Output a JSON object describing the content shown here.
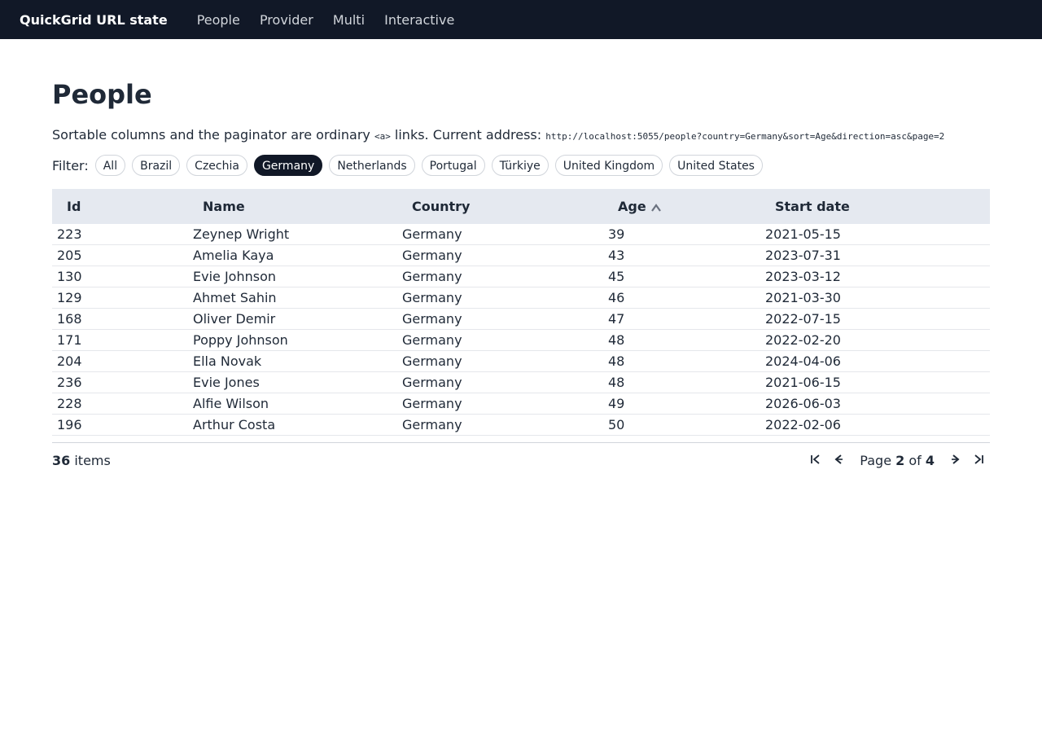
{
  "topbar": {
    "brand": "QuickGrid URL state",
    "nav": [
      "People",
      "Provider",
      "Multi",
      "Interactive"
    ]
  },
  "page": {
    "title": "People",
    "intro_before": "Sortable columns and the paginator are ordinary ",
    "intro_code": "<a>",
    "intro_after": " links. Current address: ",
    "current_address": "http://localhost:5055/people?country=Germany&sort=Age&direction=asc&page=2"
  },
  "filter": {
    "label": "Filter:",
    "options": [
      "All",
      "Brazil",
      "Czechia",
      "Germany",
      "Netherlands",
      "Portugal",
      "Türkiye",
      "United Kingdom",
      "United States"
    ],
    "selected": "Germany"
  },
  "table": {
    "columns": [
      "Id",
      "Name",
      "Country",
      "Age",
      "Start date"
    ],
    "sorted_column": "Age",
    "sort_direction": "asc",
    "rows": [
      [
        "223",
        "Zeynep Wright",
        "Germany",
        "39",
        "2021-05-15"
      ],
      [
        "205",
        "Amelia Kaya",
        "Germany",
        "43",
        "2023-07-31"
      ],
      [
        "130",
        "Evie Johnson",
        "Germany",
        "45",
        "2023-03-12"
      ],
      [
        "129",
        "Ahmet Sahin",
        "Germany",
        "46",
        "2021-03-30"
      ],
      [
        "168",
        "Oliver Demir",
        "Germany",
        "47",
        "2022-07-15"
      ],
      [
        "171",
        "Poppy Johnson",
        "Germany",
        "48",
        "2022-02-20"
      ],
      [
        "204",
        "Ella Novak",
        "Germany",
        "48",
        "2024-04-06"
      ],
      [
        "236",
        "Evie Jones",
        "Germany",
        "48",
        "2021-06-15"
      ],
      [
        "228",
        "Alfie Wilson",
        "Germany",
        "49",
        "2026-06-03"
      ],
      [
        "196",
        "Arthur Costa",
        "Germany",
        "50",
        "2022-02-06"
      ]
    ]
  },
  "footer": {
    "total_count": "36",
    "items_label": " items",
    "page_prefix": "Page ",
    "current_page": "2",
    "of_label": " of ",
    "total_pages": "4"
  },
  "icons": {
    "first": "first-page-icon",
    "prev": "previous-page-icon",
    "next": "next-page-icon",
    "last": "last-page-icon",
    "sort": "sort-ascending-icon"
  },
  "colors": {
    "topbar_bg": "#111827",
    "header_bg": "#e5e9f0",
    "active_pill_bg": "#111827"
  }
}
